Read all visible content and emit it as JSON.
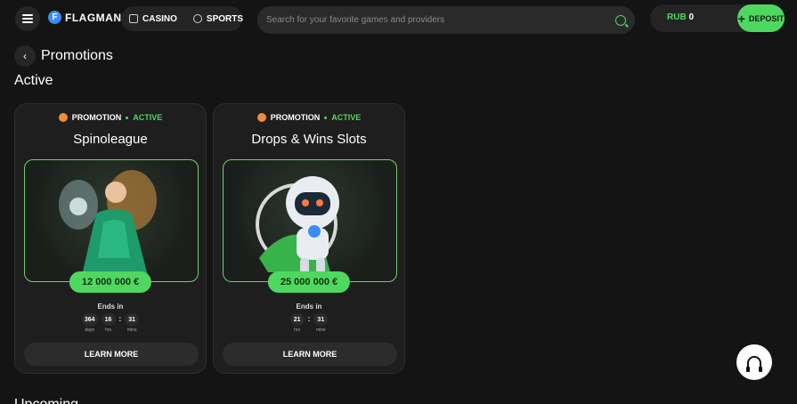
{
  "header": {
    "logo_mark": "F",
    "logo_text": "FLAGMAN",
    "nav": [
      {
        "label": "CASINO",
        "icon": "casino-icon"
      },
      {
        "label": "SPORTS",
        "icon": "sports-ball-icon"
      }
    ],
    "search_placeholder": "Search for your favorite games and providers",
    "balance_currency": "RUB",
    "balance_value": "0",
    "deposit_label": "DEPOSIT"
  },
  "page": {
    "title": "Promotions",
    "section_active": "Active",
    "section_upcoming": "Upcoming"
  },
  "colors": {
    "accent": "#4fd85f",
    "background": "#141414",
    "card": "#1e1e1e"
  },
  "promotions": [
    {
      "category": "PROMOTION",
      "status": "ACTIVE",
      "title": "Spinoleague",
      "prize": "12 000 000 €",
      "ends_label": "Ends in",
      "timer": [
        {
          "value": "364",
          "unit": "days"
        },
        {
          "value": "16",
          "unit": "hrs"
        },
        {
          "value": "31",
          "unit": "mins"
        }
      ],
      "button": "LEARN MORE"
    },
    {
      "category": "PROMOTION",
      "status": "ACTIVE",
      "title": "Drops & Wins Slots",
      "prize": "25 000 000 €",
      "ends_label": "Ends in",
      "timer": [
        {
          "value": "21",
          "unit": "hrs"
        },
        {
          "value": "31",
          "unit": "mins"
        }
      ],
      "button": "LEARN MORE"
    }
  ]
}
